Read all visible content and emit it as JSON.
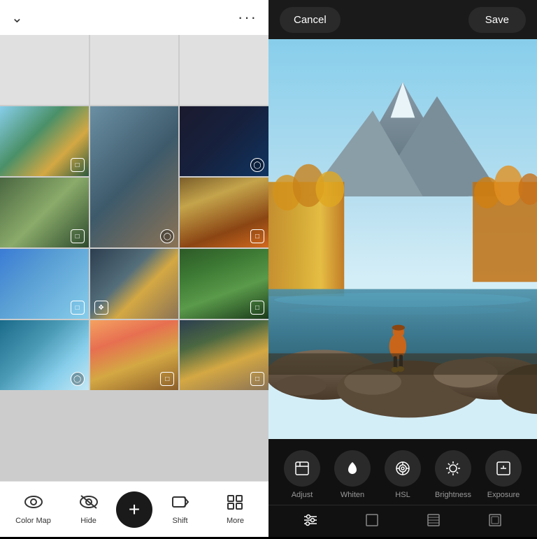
{
  "left": {
    "header": {
      "chevron_label": "chevron down",
      "more_label": "···"
    },
    "bottom_bar": {
      "items": [
        {
          "id": "color-map",
          "label": "Color Map",
          "icon": "👁"
        },
        {
          "id": "hide",
          "label": "Hide",
          "icon": "🚫"
        },
        {
          "id": "add",
          "label": "+",
          "icon": "+"
        },
        {
          "id": "shift",
          "label": "Shift",
          "icon": "→|"
        },
        {
          "id": "more",
          "label": "More",
          "icon": "⠿"
        }
      ]
    }
  },
  "right": {
    "header": {
      "cancel_label": "Cancel",
      "save_label": "Save"
    },
    "tools": [
      {
        "id": "adjust",
        "label": "Adjust",
        "icon": "⊞"
      },
      {
        "id": "whiten",
        "label": "Whiten",
        "icon": "🦷"
      },
      {
        "id": "hsl",
        "label": "HSL",
        "icon": "◎"
      },
      {
        "id": "brightness",
        "label": "Brightness",
        "icon": "☀"
      },
      {
        "id": "exposure",
        "label": "Exposure",
        "icon": "⊡"
      }
    ],
    "bottom_controls": [
      {
        "id": "sliders",
        "icon": "⊟",
        "active": true
      },
      {
        "id": "crop",
        "icon": "▢",
        "active": false
      },
      {
        "id": "texture",
        "icon": "▨",
        "active": false
      },
      {
        "id": "frame",
        "icon": "▢",
        "active": false
      }
    ]
  }
}
